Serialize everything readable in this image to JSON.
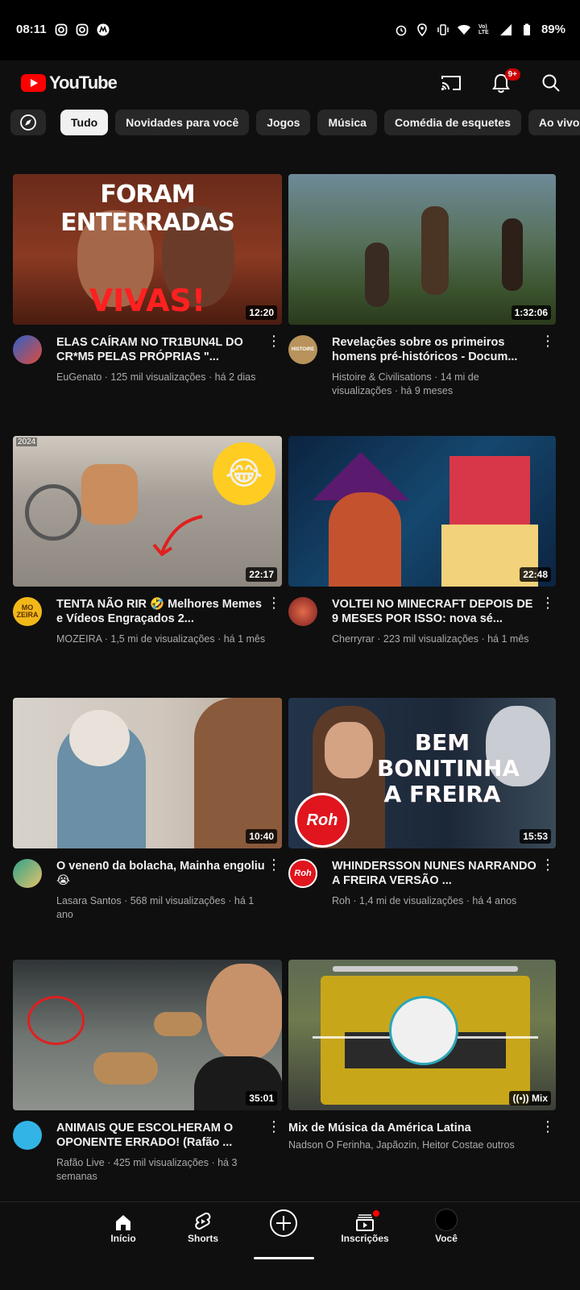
{
  "status_bar": {
    "time": "08:11",
    "battery": "89%",
    "network_label": "Vo) LTE"
  },
  "app": {
    "title": "YouTube"
  },
  "header": {
    "notification_count": "9+"
  },
  "chips": [
    "Tudo",
    "Novidades para você",
    "Jogos",
    "Música",
    "Comédia de esquetes",
    "Ao vivo"
  ],
  "videos": [
    {
      "title": "ELAS CAÍRAM NO TR1BUN4L DO CR*M5 PELAS PRÓPRIAS \"...",
      "subtitle": "EuGenato · 125 mil visualizações · há 2 dias",
      "duration": "12:20",
      "thumb_top": "FORAM ENTERRADAS",
      "thumb_bottom": "VIVAS!"
    },
    {
      "title": "Revelações sobre os primeiros homens pré-históricos - Docum...",
      "subtitle": "Histoire & Civilisations · 14 mi de visualizações · há 9 meses",
      "duration": "1:32:06",
      "avatar_text": "HISTOIRE"
    },
    {
      "title": "TENTA NÃO RIR 🤣 Melhores Memes e Vídeos Engraçados 2...",
      "subtitle": "MOZEIRA · 1,5 mi de visualizações · há 1 mês",
      "duration": "22:17",
      "thumb_tag": "2024",
      "avatar_text": "MO ZEIRA"
    },
    {
      "title": "VOLTEI NO MINECRAFT DEPOIS DE 9 MESES POR ISSO: nova sé...",
      "subtitle": "Cherryrar · 223 mil visualizações · há 1 mês",
      "duration": "22:48"
    },
    {
      "title": "O venen0 da bolacha, Mainha engoliu 😭",
      "subtitle": "Lasara Santos · 568 mil visualizações · há 1 ano",
      "duration": "10:40"
    },
    {
      "title": "WHINDERSSON NUNES NARRANDO A FREIRA VERSÃO ...",
      "subtitle": "Roh · 1,4 mi de visualizações · há 4 anos",
      "duration": "15:53",
      "thumb_text": "BEM BONITINHA A FREIRA",
      "logo_text": "Roh"
    },
    {
      "title": "ANIMAIS QUE ESCOLHERAM O OPONENTE ERRADO! (Rafão ...",
      "subtitle": "Rafão Live · 425 mil visualizações · há 3 semanas",
      "duration": "35:01"
    },
    {
      "title": "Mix de Música da América Latina",
      "subtitle": "Nadson O Ferinha, Japãozin, Heitor Costae outros",
      "duration": "Mix"
    }
  ],
  "nav": [
    {
      "label": "Início",
      "icon": "home-icon"
    },
    {
      "label": "Shorts",
      "icon": "shorts-icon"
    },
    {
      "label": "",
      "icon": "create-icon"
    },
    {
      "label": "Inscrições",
      "icon": "subscriptions-icon"
    },
    {
      "label": "Você",
      "icon": "profile-icon"
    }
  ]
}
